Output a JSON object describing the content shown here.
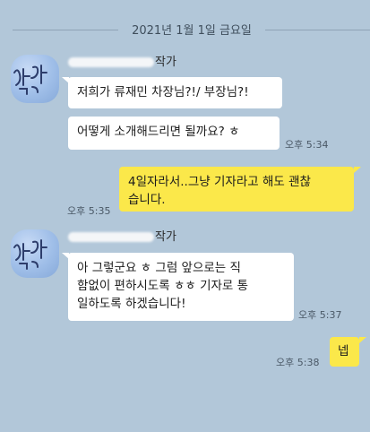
{
  "date_divider": "2021년 1월 1일 금요일",
  "messages_block_1": {
    "sender_suffix": "작가",
    "bubble_1": "저희가 류재민 차장님?!/ 부장님?!",
    "bubble_2": "어떻게 소개해드리면 될까요? ㅎ",
    "time": "오후 5:34"
  },
  "my_message_1": {
    "text_line1": "4일자라서..그냥 기자라고 해도 괜찮",
    "text_line2": "습니다.",
    "time": "오후 5:35"
  },
  "messages_block_2": {
    "sender_suffix": "작가",
    "line1": "아 그렇군요 ㅎ 그럼 앞으로는 직",
    "line2": "함없이 편하시도록 ㅎㅎ 기자로 통",
    "line3": "일하도록 하겠습니다!",
    "time": "오후 5:37"
  },
  "my_message_2": {
    "text": "넵",
    "time": "오후 5:38"
  },
  "colors": {
    "background": "#b2c7d9",
    "my_bubble": "#fbe84a",
    "their_bubble": "#ffffff"
  }
}
